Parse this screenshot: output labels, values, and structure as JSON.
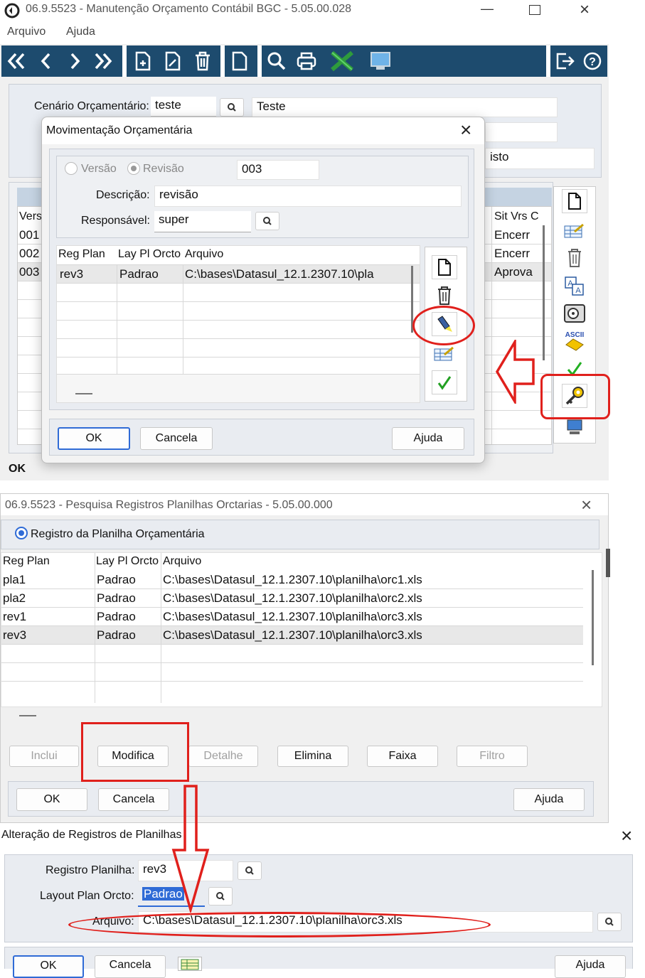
{
  "win1": {
    "title": "06.9.5523 - Manutenção Orçamento Contábil BGC - 5.05.00.028",
    "menu": [
      "Arquivo",
      "Ajuda"
    ],
    "cenario_label": "Cenário Orçamentário:",
    "cenario_value": "teste",
    "cenario_desc": "Teste",
    "behind_field_text": "isto",
    "behind_grid": {
      "col_versao": "Vers",
      "col_sit": "Sit Vrs C",
      "rows": [
        {
          "v": "001",
          "sit": "Encerr"
        },
        {
          "v": "002",
          "sit": "Encerr"
        },
        {
          "v": "003",
          "sit": "Aprova"
        }
      ]
    },
    "status": "OK"
  },
  "dialog1": {
    "title": "Movimentação Orçamentária",
    "radio_versao": "Versão",
    "radio_revisao": "Revisão",
    "num": "003",
    "descricao_label": "Descrição:",
    "descricao_value": "revisão",
    "responsavel_label": "Responsável:",
    "responsavel_value": "super",
    "columns": [
      "Reg Plan",
      "Lay Pl Orcto",
      "Arquivo"
    ],
    "rows": [
      {
        "reg": "rev3",
        "lay": "Padrao",
        "arq": "C:\\bases\\Datasul_12.1.2307.10\\pla"
      }
    ],
    "ok": "OK",
    "cancela": "Cancela",
    "ajuda": "Ajuda"
  },
  "win2": {
    "title": "06.9.5523 - Pesquisa Registros Planilhas Orctarias - 5.05.00.000",
    "radio_label": "Registro da Planilha Orçamentária",
    "columns": [
      "Reg Plan",
      "Lay Pl Orcto",
      "Arquivo"
    ],
    "rows": [
      {
        "reg": "pla1",
        "lay": "Padrao",
        "arq": "C:\\bases\\Datasul_12.1.2307.10\\planilha\\orc1.xls"
      },
      {
        "reg": "pla2",
        "lay": "Padrao",
        "arq": "C:\\bases\\Datasul_12.1.2307.10\\planilha\\orc2.xls"
      },
      {
        "reg": "rev1",
        "lay": "Padrao",
        "arq": "C:\\bases\\Datasul_12.1.2307.10\\planilha\\orc3.xls"
      },
      {
        "reg": "rev3",
        "lay": "Padrao",
        "arq": "C:\\bases\\Datasul_12.1.2307.10\\planilha\\orc3.xls"
      }
    ],
    "buttons": {
      "inclui": "Inclui",
      "modifica": "Modifica",
      "detalhe": "Detalhe",
      "elimina": "Elimina",
      "faixa": "Faixa",
      "filtro": "Filtro"
    },
    "ok": "OK",
    "cancela": "Cancela",
    "ajuda": "Ajuda"
  },
  "dialog3": {
    "title": "Alteração de Registros de Planilhas",
    "registro_label": "Registro Planilha:",
    "registro_value": "rev3",
    "layout_label": "Layout Plan Orcto:",
    "layout_value": "Padrao",
    "arquivo_label": "Arquivo:",
    "arquivo_value": "C:\\bases\\Datasul_12.1.2307.10\\planilha\\orc3.xls",
    "ok": "OK",
    "cancela": "Cancela",
    "ajuda": "Ajuda"
  },
  "colors": {
    "annotation": "#e0201c",
    "toolbar": "#1d4b6e",
    "selection": "#2f6bd6"
  }
}
